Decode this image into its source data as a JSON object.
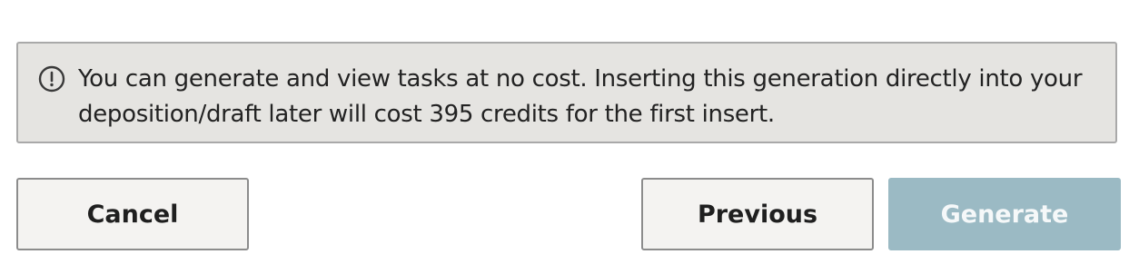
{
  "notice": {
    "icon": "exclamation-circle-icon",
    "text": "You can generate and view tasks at no cost. Inserting this generation directly into your deposition/draft later will cost 395 credits for the first insert."
  },
  "actions": {
    "cancel_label": "Cancel",
    "previous_label": "Previous",
    "generate_label": "Generate",
    "generate_color": "#9bbac4"
  }
}
